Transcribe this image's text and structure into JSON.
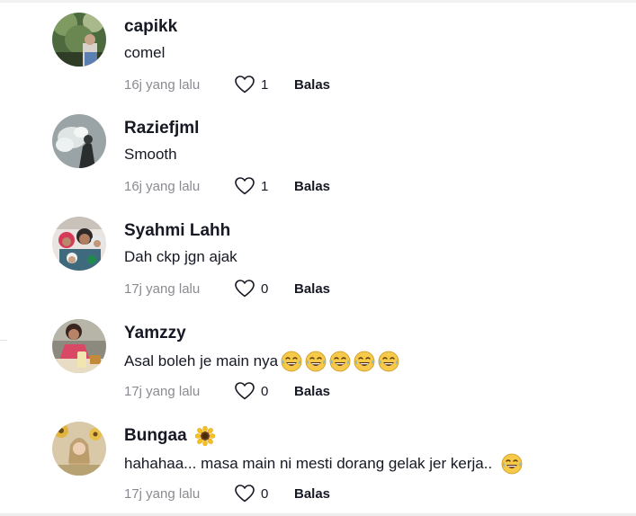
{
  "comments": [
    {
      "username": "capikk",
      "text": "comel",
      "time": "16j yang lalu",
      "likes": "1",
      "reply_label": "Balas",
      "avatar_icon": "avatar-photo"
    },
    {
      "username": "Raziefjml",
      "text": "Smooth",
      "time": "16j yang lalu",
      "likes": "1",
      "reply_label": "Balas",
      "avatar_icon": "avatar-photo"
    },
    {
      "username": "Syahmi Lahh",
      "text": "Dah ckp jgn ajak",
      "time": "17j yang lalu",
      "likes": "0",
      "reply_label": "Balas",
      "avatar_icon": "avatar-photo"
    },
    {
      "username": "Yamzzy",
      "text": "Asal boleh je main nya",
      "text_emojis": [
        "face-with-tears-of-joy",
        "face-with-tears-of-joy",
        "face-with-tears-of-joy",
        "face-with-tears-of-joy",
        "face-with-tears-of-joy"
      ],
      "time": "17j yang lalu",
      "likes": "0",
      "reply_label": "Balas",
      "avatar_icon": "avatar-photo"
    },
    {
      "username": "Bungaa",
      "username_emoji": "sunflower",
      "text": "hahahaa... masa main ni mesti dorang gelak jer kerja..",
      "text_emojis": [
        "face-with-tears-of-joy"
      ],
      "time": "17j yang lalu",
      "likes": "0",
      "reply_label": "Balas",
      "avatar_icon": "avatar-photo"
    }
  ],
  "colors": {
    "text": "#161823",
    "muted": "#8a8b91",
    "background": "#ffffff"
  },
  "icons": {
    "like": "heart-outline-icon"
  }
}
